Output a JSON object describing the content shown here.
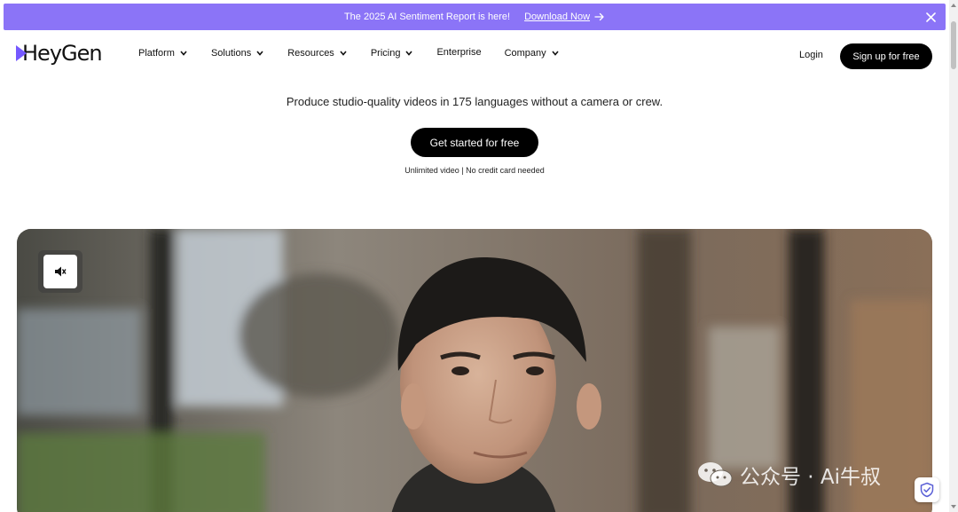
{
  "banner": {
    "message": "The 2025 AI Sentiment Report is here!",
    "cta_label": "Download Now",
    "bg_color": "#8b74f7"
  },
  "nav": {
    "logo_text": "HeyGen",
    "menu": [
      {
        "label": "Platform",
        "has_dropdown": true
      },
      {
        "label": "Solutions",
        "has_dropdown": true
      },
      {
        "label": "Resources",
        "has_dropdown": true
      },
      {
        "label": "Pricing",
        "has_dropdown": true
      },
      {
        "label": "Enterprise",
        "has_dropdown": false
      },
      {
        "label": "Company",
        "has_dropdown": true
      }
    ],
    "login_label": "Login",
    "signup_label": "Sign up for free"
  },
  "hero": {
    "tagline": "Produce studio-quality videos in 175 languages without a camera or crew.",
    "cta_label": "Get started for free",
    "note": "Unlimited video | No credit card needed"
  },
  "video": {
    "mute_icon": "speaker-muted-icon"
  },
  "watermark": {
    "text": "公众号 · Ai牛叔"
  },
  "colors": {
    "brand_purple": "#7559ff",
    "button_black": "#000000"
  }
}
